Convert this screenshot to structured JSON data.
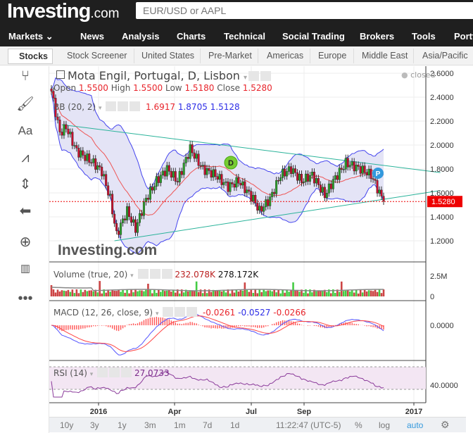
{
  "header": {
    "logo": "Investing",
    "logo_suffix": ".com",
    "search_placeholder": "EUR/USD or AAPL"
  },
  "nav": [
    "Markets ⌄",
    "News",
    "Analysis",
    "Charts",
    "Technical",
    "Social Trading",
    "Brokers",
    "Tools",
    "Portf"
  ],
  "subnav": {
    "active": "Stocks",
    "items": [
      "Stock Screener",
      "United States",
      "Pre-Market",
      "Americas",
      "Europe",
      "Middle East",
      "Asia/Pacific"
    ]
  },
  "legend": {
    "title": "Mota Engil, Portugal, D, Lisbon",
    "status": "closed",
    "ohlc": {
      "open_label": "Open",
      "open": "1.5500",
      "high_label": "High",
      "high": "1.5500",
      "low_label": "Low",
      "low": "1.5180",
      "close_label": "Close",
      "close": "1.5280"
    },
    "bb": {
      "label": "BB (20, 2)",
      "mid": "1.6917",
      "upper": "1.8705",
      "lower": "1.5128"
    },
    "volume": {
      "label": "Volume (true, 20)",
      "v1": "232.078K",
      "v2": "278.172K"
    },
    "macd": {
      "label": "MACD (12, 26, close, 9)",
      "v1": "-0.0261",
      "v2": "-0.0527",
      "v3": "-0.0266"
    },
    "rsi": {
      "label": "RSI (14)",
      "v1": "27.0733"
    }
  },
  "watermark": "Investing.com",
  "markers": {
    "d": "D",
    "p": "P"
  },
  "price_axis": [
    "2.6000",
    "2.4000",
    "2.2000",
    "2.0000",
    "1.8000",
    "1.6000",
    "1.4000",
    "1.2000"
  ],
  "last_price": "1.5280",
  "volume_axis": [
    "2.5M",
    "0"
  ],
  "macd_axis": [
    "0.0000"
  ],
  "rsi_axis": [
    "40.0000"
  ],
  "time_axis": [
    "2016",
    "Apr",
    "Jul",
    "Sep",
    "2017"
  ],
  "bottom": {
    "ranges": [
      "10y",
      "3y",
      "1y",
      "3m",
      "1m",
      "7d",
      "1d"
    ],
    "time": "11:22:47 (UTC-5)",
    "pct": "%",
    "log": "log",
    "auto": "auto"
  },
  "colors": {
    "up": "#2aa12a",
    "down": "#c8102e",
    "bb": "#4444ee",
    "trend": "#2ab39a",
    "accent": "#3399dd"
  },
  "chart_data": {
    "type": "candlestick",
    "ylim": [
      1.1,
      2.65
    ],
    "anchors": [
      [
        0,
        2.45
      ],
      [
        4,
        2.1
      ],
      [
        7,
        2.15
      ],
      [
        12,
        1.95
      ],
      [
        20,
        1.85
      ],
      [
        24,
        1.78
      ],
      [
        28,
        1.55
      ],
      [
        31,
        1.25
      ],
      [
        36,
        1.45
      ],
      [
        40,
        1.3
      ],
      [
        45,
        1.55
      ],
      [
        50,
        1.7
      ],
      [
        55,
        1.8
      ],
      [
        60,
        1.7
      ],
      [
        66,
        1.97
      ],
      [
        72,
        1.8
      ],
      [
        78,
        1.75
      ],
      [
        84,
        1.65
      ],
      [
        89,
        1.7
      ],
      [
        96,
        1.55
      ],
      [
        99,
        1.45
      ],
      [
        104,
        1.55
      ],
      [
        109,
        1.75
      ],
      [
        114,
        1.8
      ],
      [
        119,
        1.7
      ],
      [
        124,
        1.75
      ],
      [
        130,
        1.58
      ],
      [
        134,
        1.7
      ],
      [
        140,
        1.85
      ],
      [
        147,
        1.8
      ],
      [
        152,
        1.75
      ],
      [
        156,
        1.6
      ],
      [
        158,
        1.53
      ]
    ],
    "trendlines": [
      {
        "from": [
          5,
          2.17
        ],
        "to": [
          185,
          1.77
        ]
      },
      {
        "from": [
          30,
          1.2
        ],
        "to": [
          185,
          1.62
        ]
      }
    ]
  }
}
